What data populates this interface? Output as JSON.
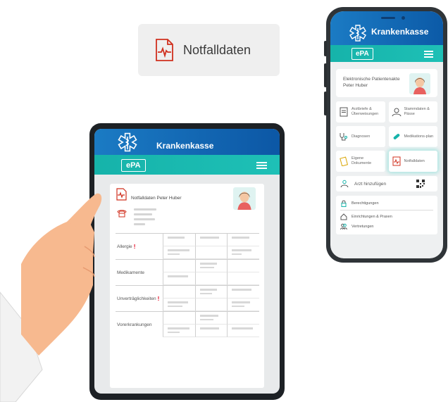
{
  "chip": {
    "label": "Notfalldaten",
    "icon": "emergency-record-icon"
  },
  "phone": {
    "brand": "Krankenkasse",
    "app_badge": "ePA",
    "profile_title": "Elektronische Patientenakte",
    "profile_name": "Peter Huber",
    "tiles": [
      {
        "label": "Arztbriefe & Überweisungen",
        "icon": "document-icon"
      },
      {
        "label": "Stammdaten & Pässe",
        "icon": "person-icon"
      },
      {
        "label": "Diagnosen",
        "icon": "stethoscope-icon"
      },
      {
        "label": "Medikations-plan",
        "icon": "pill-icon"
      },
      {
        "label": "Eigene Dokumente",
        "icon": "documents-icon"
      },
      {
        "label": "Notfalldaten",
        "icon": "emergency-record-icon"
      }
    ],
    "add_doctor": "Arzt hinzufügen",
    "list": [
      {
        "label": "Berechtigungen",
        "icon": "lock-icon"
      },
      {
        "label": "Einrichtungen & Praxen",
        "icon": "home-icon"
      },
      {
        "label": "Vertretungen",
        "icon": "people-icon"
      }
    ]
  },
  "tablet": {
    "brand": "Krankenkasse",
    "app_badge": "ePA",
    "card_title": "Notfalldaten Peter Huber",
    "sections": [
      {
        "label": "Allergie",
        "alert": "!"
      },
      {
        "label": "Medikamente",
        "alert": ""
      },
      {
        "label": "Unverträglichkeiten",
        "alert": "!"
      },
      {
        "label": "Vorerkrankungen",
        "alert": ""
      }
    ]
  },
  "colors": {
    "blue": "#0c5aa7",
    "teal": "#16b3aa",
    "alert_red": "#e3001b"
  }
}
